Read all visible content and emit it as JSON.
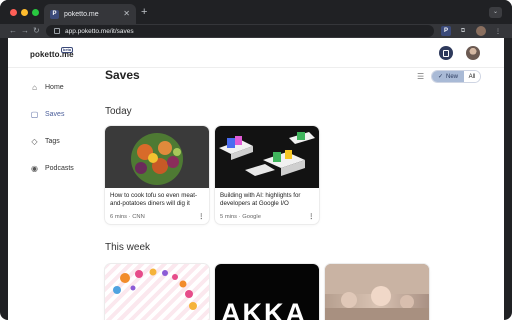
{
  "browser": {
    "tab_title": "poketto.me",
    "tab_favicon": "P",
    "url": "app.poketto.me/it/saves",
    "extension_label": "P"
  },
  "header": {
    "logo": "poketto.me",
    "badge": "beta"
  },
  "sidebar": {
    "items": [
      {
        "label": "Home",
        "icon": "home-icon"
      },
      {
        "label": "Saves",
        "icon": "bag-icon"
      },
      {
        "label": "Tags",
        "icon": "tag-icon"
      },
      {
        "label": "Podcasts",
        "icon": "podcast-icon"
      }
    ]
  },
  "main": {
    "title": "Saves",
    "toggle": {
      "new": "New",
      "all": "All"
    },
    "sections": [
      {
        "title": "Today",
        "cards": [
          {
            "title": "How to cook tofu so even meat-and-potatoes diners will dig it",
            "meta": "6 mins · CNN",
            "thumb": "food"
          },
          {
            "title": "Building with AI: highlights for developers at Google I/O",
            "meta": "5 mins · Google",
            "thumb": "ai-blocks"
          }
        ]
      },
      {
        "title": "This week",
        "cards": [
          {
            "thumb": "colorful-dots"
          },
          {
            "thumb": "akka-logo",
            "thumb_text": "AKKA"
          },
          {
            "thumb": "surreal-landscape"
          }
        ]
      }
    ]
  },
  "colors": {
    "accent": "#4a5d9a",
    "toggle_active": "#a9bad6",
    "chrome_dark": "#202124"
  }
}
